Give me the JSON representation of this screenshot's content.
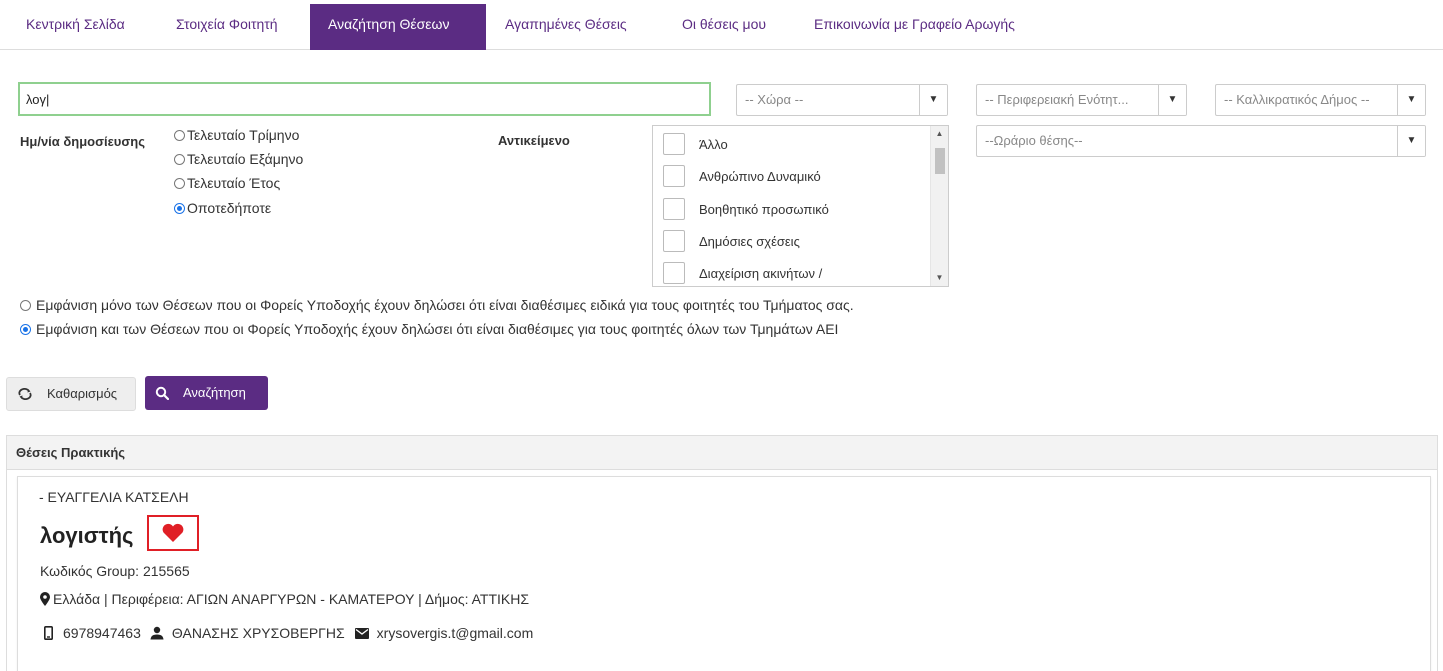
{
  "nav": {
    "tabs": [
      {
        "label": "Κεντρική Σελίδα"
      },
      {
        "label": "Στοιχεία Φοιτητή"
      },
      {
        "label": "Αναζήτηση Θέσεων"
      },
      {
        "label": "Αγαπημένες Θέσεις"
      },
      {
        "label": "Οι θέσεις μου"
      },
      {
        "label": "Επικοινωνία με Γραφείο Αρωγής"
      }
    ],
    "active_index": 2
  },
  "search": {
    "keyword_value": "λογ|"
  },
  "filters": {
    "country": "-- Χώρα --",
    "region": "-- Περιφερειακή Ενότητ...",
    "municipality": "-- Καλλικρατικός Δήμος --",
    "schedule": "--Ωράριο θέσης--",
    "pub_date_label": "Ημ/νία δημοσίευσης",
    "pub_date_options": [
      {
        "label": "Τελευταίο Τρίμηνο",
        "checked": false
      },
      {
        "label": "Τελευταίο Εξάμηνο",
        "checked": false
      },
      {
        "label": "Τελευταίο Έτος",
        "checked": false
      },
      {
        "label": "Οποτεδήποτε",
        "checked": true
      }
    ],
    "subject_label": "Αντικείμενο",
    "subject_options": [
      {
        "label": "Άλλο"
      },
      {
        "label": "Ανθρώπινο Δυναμικό"
      },
      {
        "label": "Βοηθητικό προσωπικό"
      },
      {
        "label": "Δημόσιες σχέσεις"
      },
      {
        "label": "Διαχείριση ακινήτων /"
      }
    ]
  },
  "visibility": {
    "options": [
      {
        "label": "Εμφάνιση μόνο των Θέσεων που οι Φορείς Υποδοχής έχουν δηλώσει ότι είναι διαθέσιμες ειδικά για τους φοιτητές του Τμήματος σας.",
        "checked": false
      },
      {
        "label": "Εμφάνιση και των Θέσεων που οι Φορείς Υποδοχής έχουν δηλώσει ότι είναι διαθέσιμες για τους φοιτητές όλων των Τμημάτων ΑΕΙ",
        "checked": true
      }
    ]
  },
  "buttons": {
    "clear_label": "Καθαρισμός",
    "search_label": "Αναζήτηση"
  },
  "results": {
    "panel_title": "Θέσεις Πρακτικής",
    "card": {
      "provider": "- ΕΥΑΓΓΕΛΙΑ ΚΑΤΣΕΛΗ",
      "title": "λογιστής",
      "group_code": "Κωδικός Group: 215565",
      "location": "Ελλάδα | Περιφέρεια: ΑΓΙΩΝ ΑΝΑΡΓΥΡΩΝ - ΚΑΜΑΤΕΡΟΥ | Δήμος: ΑΤΤΙΚΗΣ",
      "phone": "6978947463",
      "contact_person": "ΘΑΝΑΣΗΣ ΧΡΥΣΟΒΕΡΓΗΣ",
      "email": "xrysovergis.t@gmail.com"
    }
  },
  "colors": {
    "brand": "#5b2c83",
    "favorite": "#e01f26",
    "radio_selected": "#1a73e8"
  }
}
